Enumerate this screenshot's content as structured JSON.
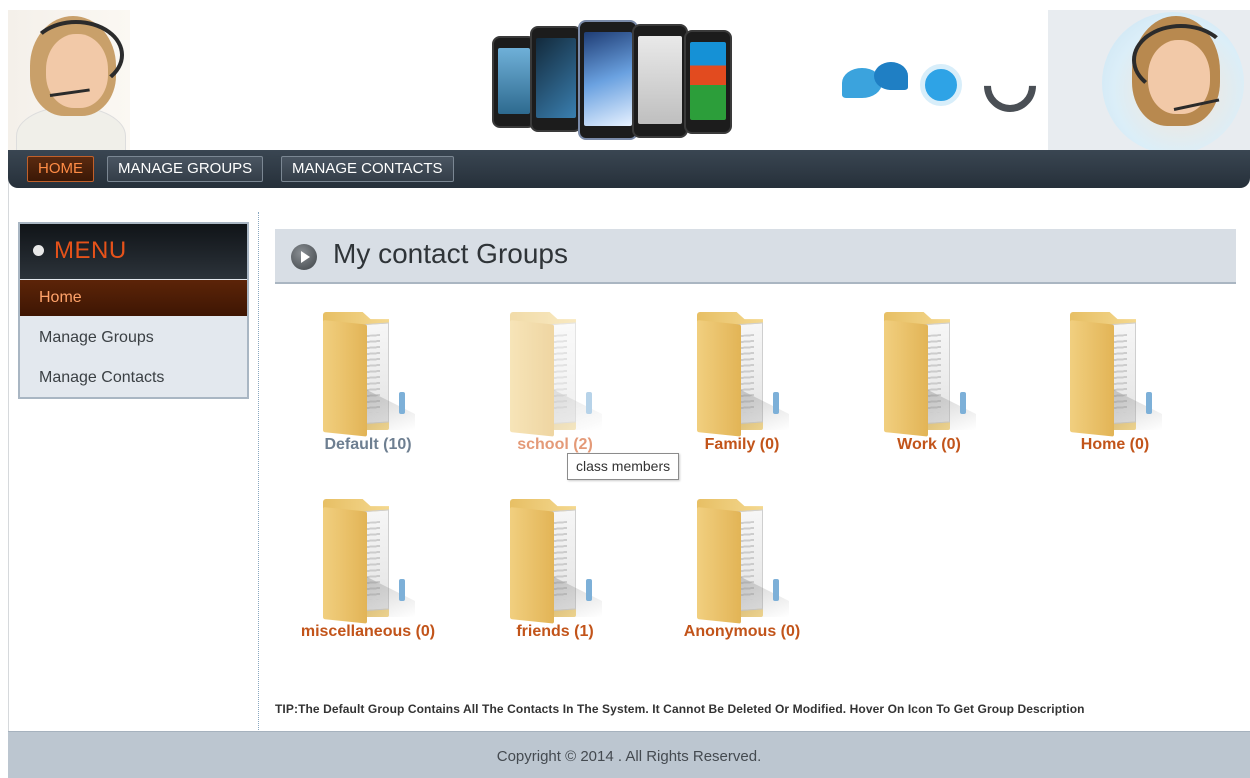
{
  "nav": {
    "tabs": [
      {
        "label": "HOME",
        "active": true
      },
      {
        "label": "MANAGE GROUPS",
        "active": false
      },
      {
        "label": "MANAGE CONTACTS",
        "active": false
      }
    ]
  },
  "sidebar": {
    "title": "MENU",
    "items": [
      {
        "label": "Home",
        "active": true
      },
      {
        "label": "Manage Groups",
        "active": false
      },
      {
        "label": "Manage Contacts",
        "active": false
      }
    ]
  },
  "main": {
    "title": "My contact Groups",
    "groups": [
      {
        "label": "Default (10)",
        "icon": "folder-icon"
      },
      {
        "label": "school (2)",
        "icon": "folder-icon"
      },
      {
        "label": "Family (0)",
        "icon": "folder-icon"
      },
      {
        "label": "Work (0)",
        "icon": "folder-icon"
      },
      {
        "label": "Home (0)",
        "icon": "folder-icon"
      },
      {
        "label": "miscellaneous (0)",
        "icon": "folder-icon"
      },
      {
        "label": "friends (1)",
        "icon": "folder-icon"
      },
      {
        "label": "Anonymous (0)",
        "icon": "folder-icon"
      }
    ],
    "tooltip": "class members",
    "tip": "TIP:The Default Group Contains All The Contacts In The System. It Cannot Be Deleted Or Modified. Hover On Icon To Get Group Description"
  },
  "footer": {
    "copyright": "Copyright © 2014 . All Rights Reserved."
  },
  "colors": {
    "nav_bg": "#2f3a45",
    "accent_orange": "#c2541a",
    "menu_title": "#e6521a",
    "footer_bg": "#bcc6d0"
  }
}
